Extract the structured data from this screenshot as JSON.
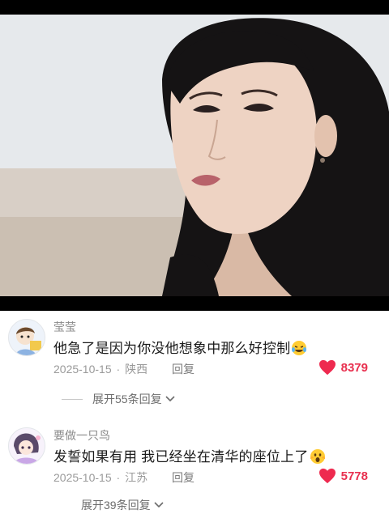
{
  "comments": [
    {
      "user": "莹莹",
      "text": "他急了是因为你没他想象中那么好控制",
      "emoji": "rolling-laughing-emoji",
      "date": "2025-10-15",
      "sep": "·",
      "location": "陕西",
      "reply_label": "回复",
      "likes": "8379",
      "expand_label": "展开55条回复"
    },
    {
      "user": "要做一只鸟",
      "text": "发誓如果有用 我已经坐在清华的座位上了",
      "emoji": "shocked-emoji",
      "date": "2025-10-15",
      "sep": "·",
      "location": "江苏",
      "reply_label": "回复",
      "likes": "5778",
      "expand_label": "展开39条回复"
    }
  ],
  "colors": {
    "like": "#e8304f",
    "text": "#1b1b1b",
    "meta": "#9a9a9a"
  }
}
